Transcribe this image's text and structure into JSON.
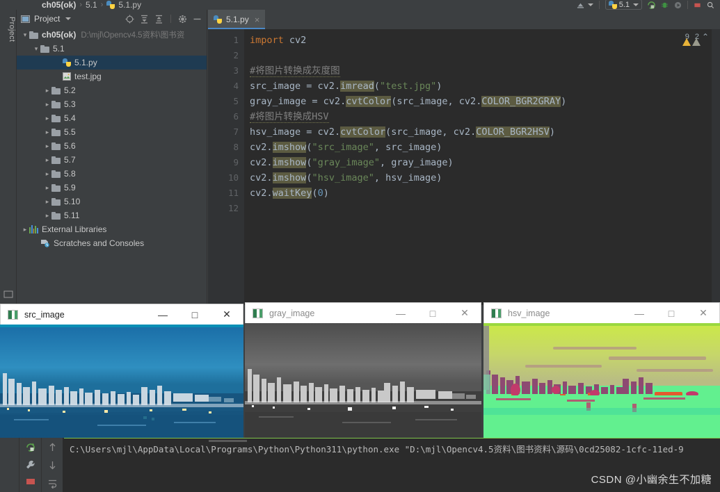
{
  "breadcrumb": {
    "items": [
      "ch05(ok)",
      "5.1",
      "5.1.py"
    ],
    "sep": "›"
  },
  "top_toolbar": {
    "run_config_name": "5.1",
    "icons": [
      {
        "name": "device-manager-icon",
        "glyph": "▲"
      },
      {
        "name": "run-config-python-icon",
        "glyph": ""
      },
      {
        "name": "dropdown-caret-icon",
        "glyph": "▾"
      },
      {
        "name": "run-icon",
        "glyph": "▶"
      },
      {
        "name": "debug-icon",
        "glyph": "⚙"
      },
      {
        "name": "coverage-icon",
        "glyph": "◐"
      },
      {
        "name": "stop-icon",
        "glyph": "■"
      },
      {
        "name": "search-everywhere-icon",
        "glyph": "⌕"
      }
    ]
  },
  "left_strip": {
    "label": "Project"
  },
  "project_panel": {
    "title": "Project",
    "buttons": [
      {
        "name": "locate-file-button",
        "glyph": "⊕"
      },
      {
        "name": "expand-all-button",
        "glyph": "⤓"
      },
      {
        "name": "collapse-all-button",
        "glyph": "⤒"
      },
      {
        "name": "settings-gear-button",
        "glyph": "⚙"
      },
      {
        "name": "hide-panel-button",
        "glyph": "—"
      }
    ],
    "tree": [
      {
        "label": "ch05(ok)",
        "path": "D:\\mjl\\Opencv4.5资料\\图书资",
        "indent": 0,
        "arrow": "open",
        "icon": "folder",
        "bold": true,
        "selected": false
      },
      {
        "label": "5.1",
        "path": "",
        "indent": 1,
        "arrow": "open",
        "icon": "folder",
        "bold": false,
        "selected": false
      },
      {
        "label": "5.1.py",
        "path": "",
        "indent": 3,
        "arrow": "none",
        "icon": "python",
        "bold": false,
        "selected": true
      },
      {
        "label": "test.jpg",
        "path": "",
        "indent": 3,
        "arrow": "none",
        "icon": "image",
        "bold": false,
        "selected": false
      },
      {
        "label": "5.2",
        "path": "",
        "indent": 2,
        "arrow": "closed",
        "icon": "folder",
        "bold": false,
        "selected": false
      },
      {
        "label": "5.3",
        "path": "",
        "indent": 2,
        "arrow": "closed",
        "icon": "folder",
        "bold": false,
        "selected": false
      },
      {
        "label": "5.4",
        "path": "",
        "indent": 2,
        "arrow": "closed",
        "icon": "folder",
        "bold": false,
        "selected": false
      },
      {
        "label": "5.5",
        "path": "",
        "indent": 2,
        "arrow": "closed",
        "icon": "folder",
        "bold": false,
        "selected": false
      },
      {
        "label": "5.6",
        "path": "",
        "indent": 2,
        "arrow": "closed",
        "icon": "folder",
        "bold": false,
        "selected": false
      },
      {
        "label": "5.7",
        "path": "",
        "indent": 2,
        "arrow": "closed",
        "icon": "folder",
        "bold": false,
        "selected": false
      },
      {
        "label": "5.8",
        "path": "",
        "indent": 2,
        "arrow": "closed",
        "icon": "folder",
        "bold": false,
        "selected": false
      },
      {
        "label": "5.9",
        "path": "",
        "indent": 2,
        "arrow": "closed",
        "icon": "folder",
        "bold": false,
        "selected": false
      },
      {
        "label": "5.10",
        "path": "",
        "indent": 2,
        "arrow": "closed",
        "icon": "folder",
        "bold": false,
        "selected": false
      },
      {
        "label": "5.11",
        "path": "",
        "indent": 2,
        "arrow": "closed",
        "icon": "folder",
        "bold": false,
        "selected": false
      },
      {
        "label": "External Libraries",
        "path": "",
        "indent": 0,
        "arrow": "closed",
        "icon": "library",
        "bold": false,
        "selected": false
      },
      {
        "label": "Scratches and Consoles",
        "path": "",
        "indent": 1,
        "arrow": "none",
        "icon": "scratch",
        "bold": false,
        "selected": false
      }
    ]
  },
  "editor": {
    "tab": {
      "label": "5.1.py",
      "close_glyph": "×"
    },
    "inspections": {
      "warning_count": "9",
      "weak_warning_count": "2",
      "chevron": "⌃"
    },
    "line_numbers": [
      "1",
      "2",
      "3",
      "4",
      "5",
      "6",
      "7",
      "8",
      "9",
      "10",
      "11",
      "12"
    ],
    "lines": [
      {
        "n": 1,
        "text": "import cv2"
      },
      {
        "n": 2,
        "text": ""
      },
      {
        "n": 3,
        "text": "#将图片转换成灰度图"
      },
      {
        "n": 4,
        "text": "src_image = cv2.imread(\"test.jpg\")"
      },
      {
        "n": 5,
        "text": "gray_image = cv2.cvtColor(src_image, cv2.COLOR_BGR2GRAY)"
      },
      {
        "n": 6,
        "text": "#将图片转换成HSV"
      },
      {
        "n": 7,
        "text": "hsv_image = cv2.cvtColor(src_image, cv2.COLOR_BGR2HSV)"
      },
      {
        "n": 8,
        "text": "cv2.imshow(\"src_image\", src_image)"
      },
      {
        "n": 9,
        "text": "cv2.imshow(\"gray_image\", gray_image)"
      },
      {
        "n": 10,
        "text": "cv2.imshow(\"hsv_image\", hsv_image)"
      },
      {
        "n": 11,
        "text": "cv2.waitKey(0)"
      },
      {
        "n": 12,
        "text": ""
      }
    ]
  },
  "cv_windows": [
    {
      "title": "src_image",
      "active": true,
      "accent_color": "#0a8fb5",
      "minimize": "—",
      "maximize": "□",
      "close": "✕"
    },
    {
      "title": "gray_image",
      "active": false,
      "accent_color": "#ffffff",
      "minimize": "—",
      "maximize": "□",
      "close": "✕"
    },
    {
      "title": "hsv_image",
      "active": false,
      "accent_color": "#9ad83f",
      "minimize": "—",
      "maximize": "□",
      "close": "✕"
    }
  ],
  "console": {
    "output": "C:\\Users\\mjl\\AppData\\Local\\Programs\\Python\\Python311\\python.exe \"D:\\mjl\\Opencv4.5资料\\图书资料\\源码\\0cd25082-1cfc-11ed-9",
    "buttons": [
      {
        "name": "rerun-button",
        "glyph": "↻"
      },
      {
        "name": "wrench-settings-button",
        "glyph": "ὒ7"
      },
      {
        "name": "stop-button",
        "glyph": "■"
      },
      {
        "name": "scroll-up-button",
        "glyph": "↑"
      },
      {
        "name": "scroll-down-button",
        "glyph": "↓"
      },
      {
        "name": "soft-wrap-button",
        "glyph": "↲"
      }
    ]
  },
  "watermark": {
    "text": "CSDN @小幽余生不加糖"
  },
  "colors": {
    "ide_bg": "#3c3f41",
    "editor_bg": "#2b2b2b",
    "selection_blue": "#1f3b52",
    "tab_active": "#4e5254",
    "accent_blue": "#4a88c7",
    "warning_yellow": "#e8b339",
    "console_green": "#7ec24a"
  }
}
